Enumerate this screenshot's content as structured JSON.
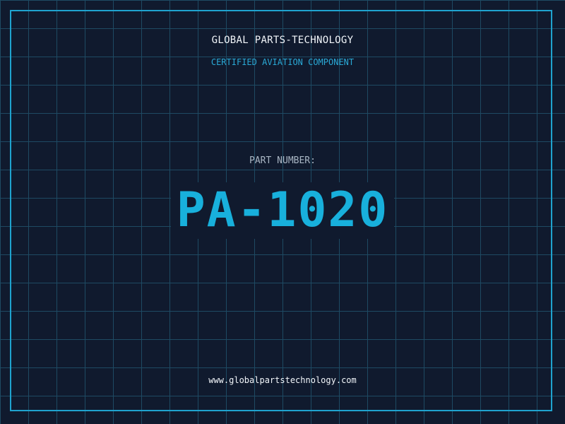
{
  "header": {
    "company_name": "GLOBAL PARTS-TECHNOLOGY",
    "tagline": "CERTIFIED AVIATION COMPONENT"
  },
  "part": {
    "label": "PART NUMBER:",
    "number": "PA-1020"
  },
  "footer": {
    "website": "www.globalpartstechnology.com"
  },
  "colors": {
    "background": "#101a2e",
    "grid": "#1e4a63",
    "accent": "#18b0dc",
    "frame": "#1fa3cf",
    "text_light": "#f2f6fa",
    "text_muted": "#a9b6c4"
  }
}
